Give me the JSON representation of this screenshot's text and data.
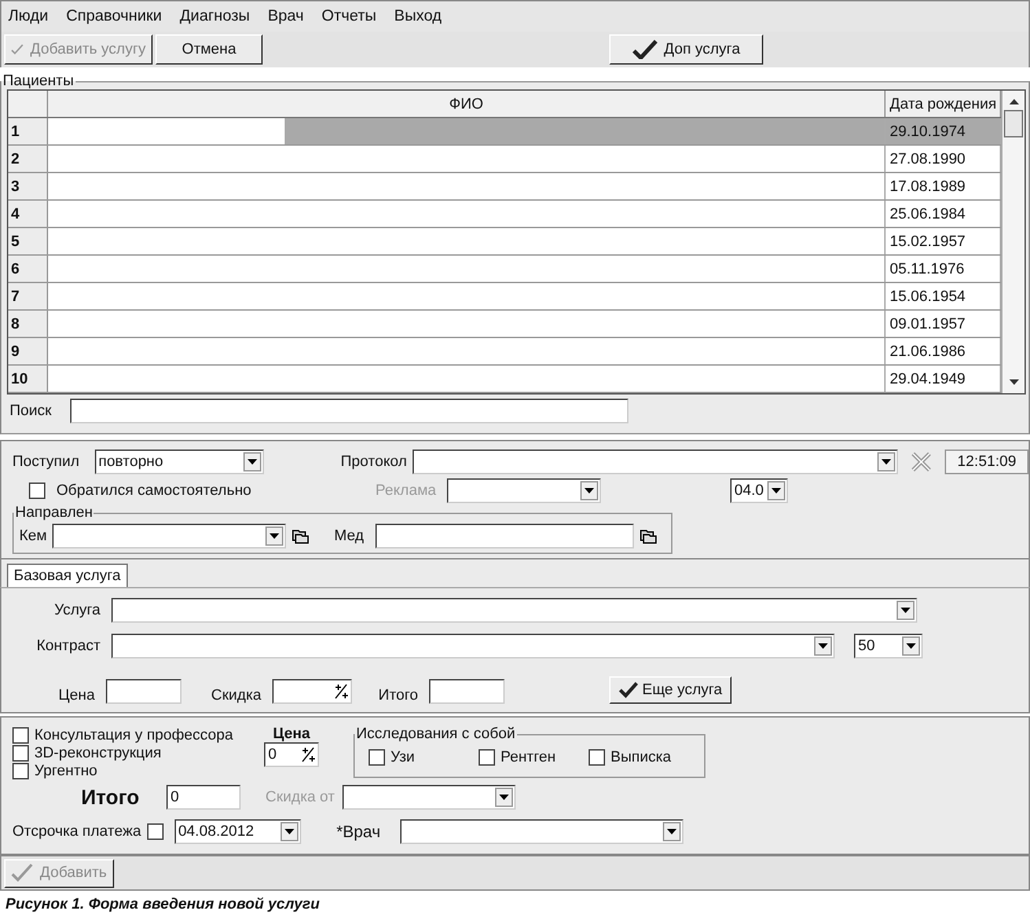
{
  "menu": [
    "Люди",
    "Справочники",
    "Диагнозы",
    "Врач",
    "Отчеты",
    "Выход"
  ],
  "toolbar": {
    "add_service": {
      "label": "Добавить услугу",
      "disabled": true
    },
    "cancel": {
      "label": "Отмена",
      "disabled": false
    },
    "extra_service": {
      "label": "Доп услуга",
      "disabled": false
    }
  },
  "patients": {
    "title": "Пациенты",
    "columns": [
      "ФИО",
      "Дата рождения"
    ],
    "rows": [
      {
        "number": "1",
        "birth_date": "29.10.1974",
        "selected": true
      },
      {
        "number": "2",
        "birth_date": "27.08.1990",
        "selected": false
      },
      {
        "number": "3",
        "birth_date": "17.08.1989",
        "selected": false
      },
      {
        "number": "4",
        "birth_date": "25.06.1984",
        "selected": false
      },
      {
        "number": "5",
        "birth_date": "15.02.1957",
        "selected": false
      },
      {
        "number": "6",
        "birth_date": "05.11.1976",
        "selected": false
      },
      {
        "number": "7",
        "birth_date": "15.06.1954",
        "selected": false
      },
      {
        "number": "8",
        "birth_date": "09.01.1957",
        "selected": false
      },
      {
        "number": "9",
        "birth_date": "21.06.1986",
        "selected": false
      },
      {
        "number": "10",
        "birth_date": "29.04.1949",
        "selected": false
      }
    ],
    "search": {
      "label": "Поиск"
    }
  },
  "admission": {
    "label": "Поступил",
    "value": "повторно"
  },
  "self_referred": {
    "label": "Обратился самостоятельно",
    "checked": false
  },
  "protocol": {
    "label": "Протокол",
    "disabled": false
  },
  "advertising": {
    "label": "Реклама",
    "disabled": true
  },
  "date_short": "04.0",
  "time": "12:51:09",
  "referral": {
    "title": "Направлен",
    "by_label": "Кем",
    "med_label": "Мед"
  },
  "service_tabs": [
    {
      "label": "Базовая услуга",
      "selected": true
    }
  ],
  "service": {
    "service_label": "Услуга",
    "contrast_label": "Контраст",
    "contrast_percent": "50",
    "price_label": "Цена",
    "discount_label": "Скидка",
    "total_label": "Итого",
    "more_button": "Еще услуга"
  },
  "options": [
    {
      "label": "Консультация у профессора",
      "checked": false
    },
    {
      "label": "3D-реконструкция",
      "checked": false
    },
    {
      "label": "Ургентно",
      "checked": false
    }
  ],
  "price": {
    "label": "Цена",
    "value": "0"
  },
  "studies": {
    "title": "Исследования с собой",
    "items": [
      {
        "label": "Узи",
        "checked": false
      },
      {
        "label": "Рентген",
        "checked": false
      },
      {
        "label": "Выписка",
        "checked": false
      }
    ]
  },
  "total": {
    "label": "Итого",
    "value": "0"
  },
  "discount_from": {
    "label": "Скидка от",
    "disabled": true
  },
  "deferral": {
    "label": "Отсрочка платежа",
    "checked": false,
    "date": "04.08.2012"
  },
  "doctor": {
    "label": "*Врач"
  },
  "add_button": {
    "label": "Добавить",
    "disabled": true
  },
  "caption": "Рисунок 1. Форма введения новой услуги"
}
